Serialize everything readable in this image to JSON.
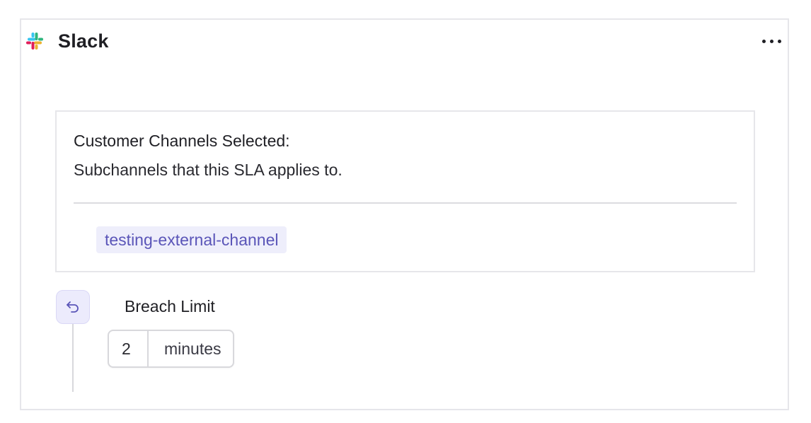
{
  "integration": {
    "title": "Slack",
    "icon": "slack-logo-icon",
    "more_icon": "more-horizontal-icon"
  },
  "channels": {
    "heading": "Customer Channels Selected:",
    "subtitle": "Subchannels that this SLA applies to.",
    "tags": [
      "testing-external-channel"
    ]
  },
  "breach": {
    "icon": "undo-arrow-icon",
    "label": "Breach Limit",
    "value": "2",
    "unit": "minutes"
  },
  "colors": {
    "accent": "#5a55b8",
    "tag_bg": "#eeeefb",
    "border": "#e6e6ea"
  }
}
